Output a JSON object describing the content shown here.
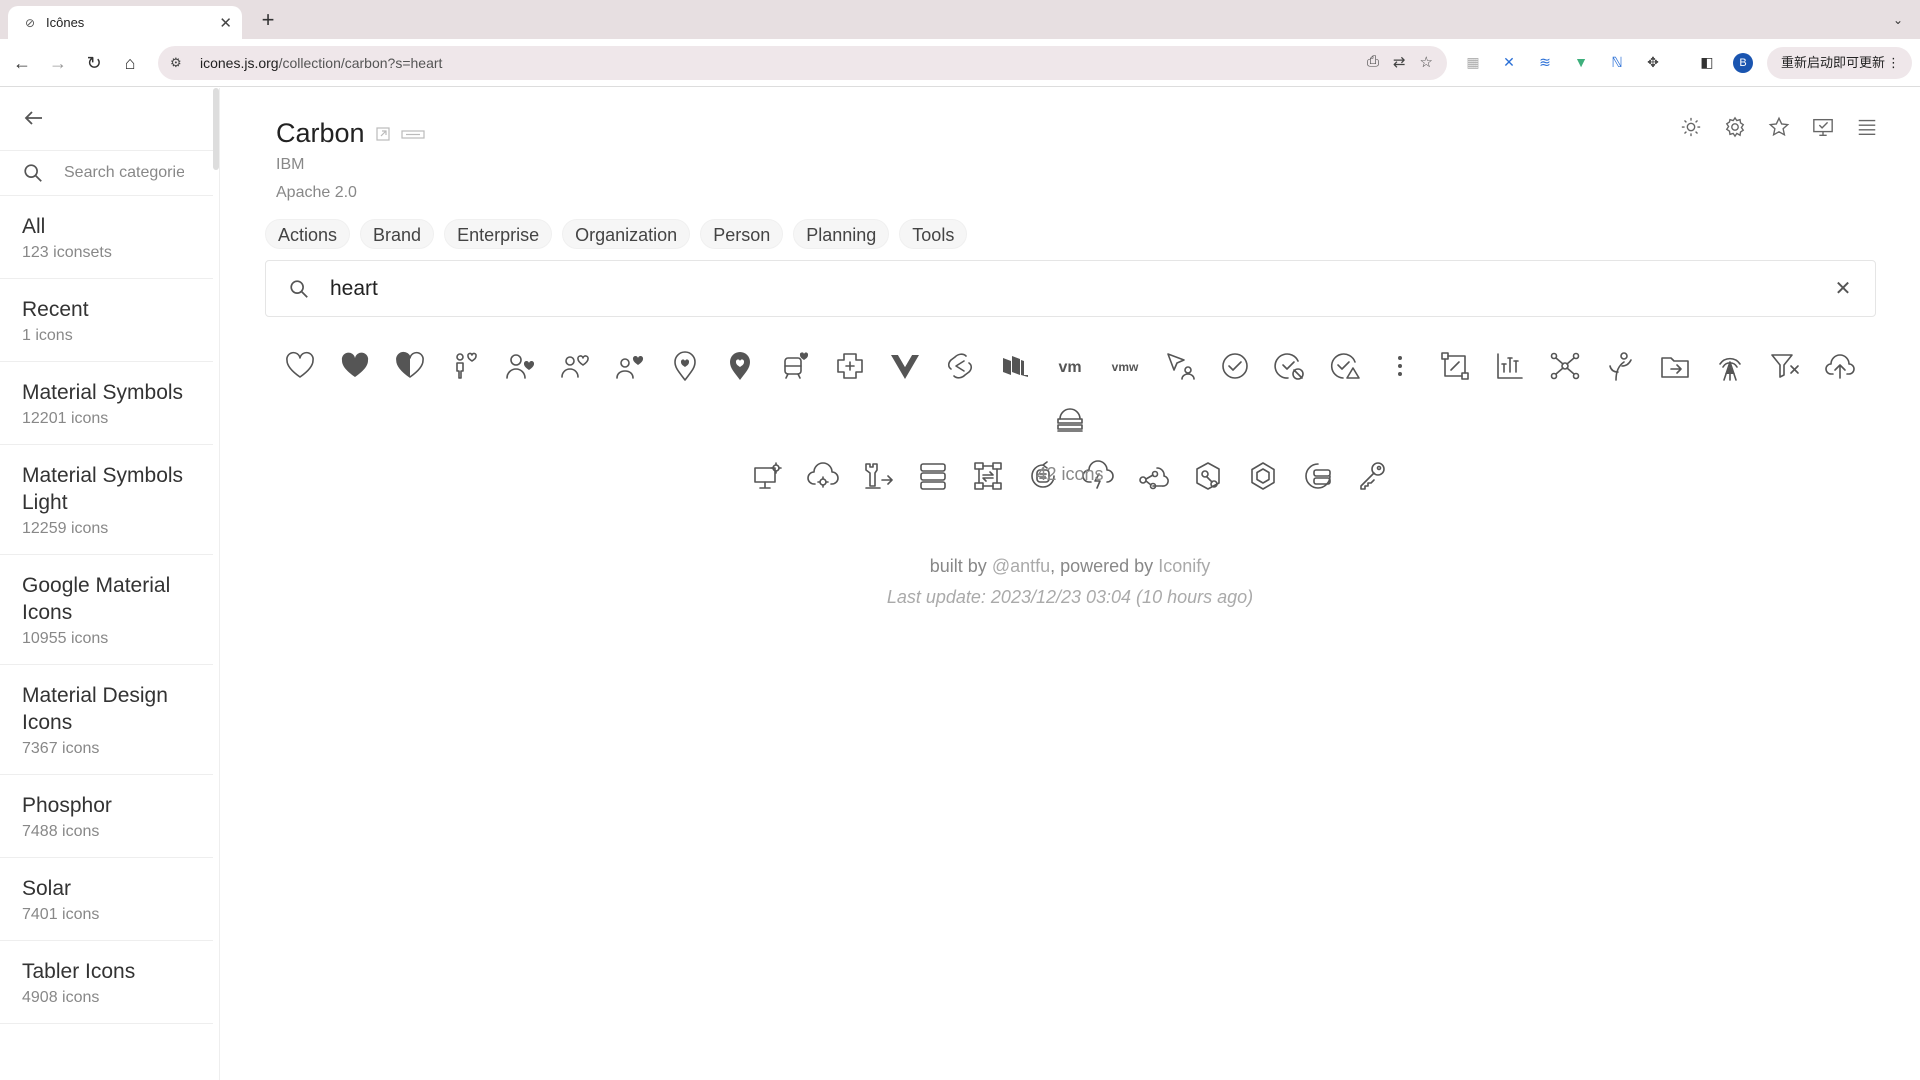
{
  "browser": {
    "tab_title": "Icônes",
    "url_host": "icones.js.org",
    "url_path": "/collection/carbon?s=heart",
    "profile_initial": "B",
    "update_button": "重新启动即可更新"
  },
  "sidebar": {
    "search_placeholder": "Search categories",
    "categories": [
      {
        "name": "All",
        "count": "123 iconsets"
      },
      {
        "name": "Recent",
        "count": "1 icons"
      },
      {
        "name": "Material Symbols",
        "count": "12201 icons"
      },
      {
        "name": "Material Symbols Light",
        "count": "12259 icons"
      },
      {
        "name": "Google Material Icons",
        "count": "10955 icons"
      },
      {
        "name": "Material Design Icons",
        "count": "7367 icons"
      },
      {
        "name": "Phosphor",
        "count": "7488 icons"
      },
      {
        "name": "Solar",
        "count": "7401 icons"
      },
      {
        "name": "Tabler Icons",
        "count": "4908 icons"
      }
    ]
  },
  "collection": {
    "title": "Carbon",
    "author": "IBM",
    "license": "Apache 2.0",
    "tags": [
      "Actions",
      "Brand",
      "Enterprise",
      "Organization",
      "Person",
      "Planning",
      "Tools"
    ],
    "search_value": "heart",
    "icon_count": "42 icons"
  },
  "icons": [
    "heart-outline-icon",
    "heart-filled-icon",
    "heart-half-icon",
    "user-favorite-alt-icon",
    "user-favorite-icon",
    "user-multiple-favorite-icon",
    "user-favorite-alt-filled-icon",
    "location-heart-icon",
    "location-heart-filled-icon",
    "train-heart-icon",
    "health-cross-icon",
    "vue-brand-icon",
    "svelte-brand-icon",
    "carbon-brand-icon",
    "vm-brand-icon",
    "vmw-brand-icon",
    "cursor-user-icon",
    "checkmark-outline-icon",
    "checkmark-disable-icon",
    "checkmark-warning-icon",
    "overflow-menu-vertical-icon",
    "transform-icon",
    "chart-bar-icon",
    "network-nodes-icon",
    "tree-branch-icon",
    "folder-move-icon",
    "radio-tower-icon",
    "filter-remove-icon",
    "cloud-upload-icon",
    "cloud-stack-icon",
    "desktop-settings-icon",
    "cloud-settings-icon",
    "tower-move-icon",
    "server-stack-icon",
    "flow-chart-icon",
    "data-refresh-icon",
    "cloud-lightning-icon",
    "share-cloud-icon",
    "settings-network-icon",
    "hexagon-outline-icon",
    "storage-pool-icon",
    "key-user-icon"
  ],
  "footer": {
    "built_by_prefix": "built by ",
    "author_link": "@antfu",
    "powered_prefix": ", powered by ",
    "powered_link": "Iconify",
    "last_update": "Last update: 2023/12/23 03:04 (10 hours ago)"
  }
}
